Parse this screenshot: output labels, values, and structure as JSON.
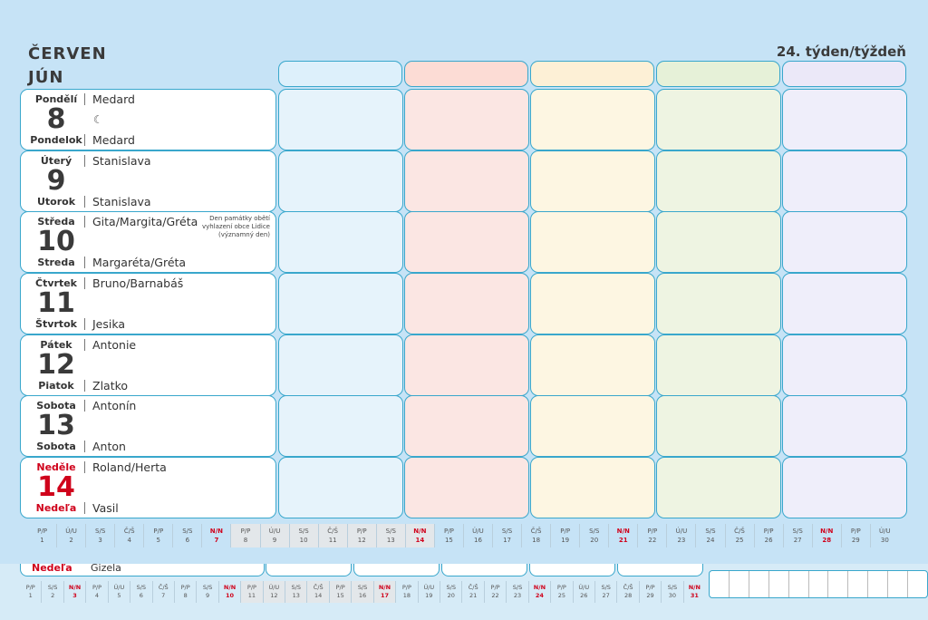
{
  "header": {
    "month_cz": "ČERVEN",
    "month_sk": "JÚN",
    "week": "24. týden/týždeň"
  },
  "days": [
    {
      "cz_day": "Pondělí",
      "sk_day": "Pondelok",
      "num": "8",
      "cz_name": "Medard",
      "sk_name": "Medard",
      "moon": "☾",
      "note": "",
      "sunday": false
    },
    {
      "cz_day": "Úterý",
      "sk_day": "Utorok",
      "num": "9",
      "cz_name": "Stanislava",
      "sk_name": "Stanislava",
      "moon": "",
      "note": "",
      "sunday": false
    },
    {
      "cz_day": "Středa",
      "sk_day": "Streda",
      "num": "10",
      "cz_name": "Gita/Margita/Gréta",
      "sk_name": "Margaréta/Gréta",
      "moon": "",
      "note": "Den památky obětí vyhlazení obce Lidice (významný den)",
      "sunday": false
    },
    {
      "cz_day": "Čtvrtek",
      "sk_day": "Štvrtok",
      "num": "11",
      "cz_name": "Bruno/Barnabáš",
      "sk_name": "Jesika",
      "moon": "",
      "note": "",
      "sunday": false
    },
    {
      "cz_day": "Pátek",
      "sk_day": "Piatok",
      "num": "12",
      "cz_name": "Antonie",
      "sk_name": "Zlatko",
      "moon": "",
      "note": "",
      "sunday": false
    },
    {
      "cz_day": "Sobota",
      "sk_day": "Sobota",
      "num": "13",
      "cz_name": "Antonín",
      "sk_name": "Anton",
      "moon": "",
      "note": "",
      "sunday": false
    },
    {
      "cz_day": "Neděle",
      "sk_day": "Nedeľa",
      "num": "14",
      "cz_name": "Roland/Herta",
      "sk_name": "Vasil",
      "moon": "",
      "note": "",
      "sunday": true
    }
  ],
  "mini_calendar": [
    {
      "abbr": "P/P",
      "d": "1"
    },
    {
      "abbr": "Ú/U",
      "d": "2"
    },
    {
      "abbr": "S/S",
      "d": "3"
    },
    {
      "abbr": "Č/Š",
      "d": "4"
    },
    {
      "abbr": "P/P",
      "d": "5"
    },
    {
      "abbr": "S/S",
      "d": "6"
    },
    {
      "abbr": "N/N",
      "d": "7",
      "red": true
    },
    {
      "abbr": "P/P",
      "d": "8",
      "hl": true
    },
    {
      "abbr": "Ú/U",
      "d": "9",
      "hl": true
    },
    {
      "abbr": "S/S",
      "d": "10",
      "hl": true
    },
    {
      "abbr": "Č/Š",
      "d": "11",
      "hl": true
    },
    {
      "abbr": "P/P",
      "d": "12",
      "hl": true
    },
    {
      "abbr": "S/S",
      "d": "13",
      "hl": true
    },
    {
      "abbr": "N/N",
      "d": "14",
      "red": true,
      "hl": true
    },
    {
      "abbr": "P/P",
      "d": "15"
    },
    {
      "abbr": "Ú/U",
      "d": "16"
    },
    {
      "abbr": "S/S",
      "d": "17"
    },
    {
      "abbr": "Č/Š",
      "d": "18"
    },
    {
      "abbr": "P/P",
      "d": "19"
    },
    {
      "abbr": "S/S",
      "d": "20"
    },
    {
      "abbr": "N/N",
      "d": "21",
      "red": true
    },
    {
      "abbr": "P/P",
      "d": "22"
    },
    {
      "abbr": "Ú/U",
      "d": "23"
    },
    {
      "abbr": "S/S",
      "d": "24"
    },
    {
      "abbr": "Č/Š",
      "d": "25"
    },
    {
      "abbr": "P/P",
      "d": "26"
    },
    {
      "abbr": "S/S",
      "d": "27"
    },
    {
      "abbr": "N/N",
      "d": "28",
      "red": true
    },
    {
      "abbr": "P/P",
      "d": "29"
    },
    {
      "abbr": "Ú/U",
      "d": "30"
    }
  ],
  "lower": {
    "sunday_label": "Nedeľa",
    "name": "Gizela"
  },
  "mini_calendar_2": [
    {
      "abbr": "P/P",
      "d": "1"
    },
    {
      "abbr": "S/S",
      "d": "2"
    },
    {
      "abbr": "N/N",
      "d": "3",
      "red": true
    },
    {
      "abbr": "P/P",
      "d": "4"
    },
    {
      "abbr": "Ú/U",
      "d": "5"
    },
    {
      "abbr": "S/S",
      "d": "6"
    },
    {
      "abbr": "Č/Š",
      "d": "7"
    },
    {
      "abbr": "P/P",
      "d": "8"
    },
    {
      "abbr": "S/S",
      "d": "9"
    },
    {
      "abbr": "N/N",
      "d": "10",
      "red": true
    },
    {
      "abbr": "P/P",
      "d": "11",
      "hl": true
    },
    {
      "abbr": "Ú/U",
      "d": "12",
      "hl": true
    },
    {
      "abbr": "S/S",
      "d": "13",
      "hl": true
    },
    {
      "abbr": "Č/Š",
      "d": "14",
      "hl": true
    },
    {
      "abbr": "P/P",
      "d": "15",
      "hl": true
    },
    {
      "abbr": "S/S",
      "d": "16",
      "hl": true
    },
    {
      "abbr": "N/N",
      "d": "17",
      "red": true,
      "hl": true
    },
    {
      "abbr": "P/P",
      "d": "18"
    },
    {
      "abbr": "Ú/U",
      "d": "19"
    },
    {
      "abbr": "S/S",
      "d": "20"
    },
    {
      "abbr": "Č/Š",
      "d": "21"
    },
    {
      "abbr": "P/P",
      "d": "22"
    },
    {
      "abbr": "S/S",
      "d": "23"
    },
    {
      "abbr": "N/N",
      "d": "24",
      "red": true
    },
    {
      "abbr": "P/P",
      "d": "25"
    },
    {
      "abbr": "Ú/U",
      "d": "26"
    },
    {
      "abbr": "S/S",
      "d": "27"
    },
    {
      "abbr": "Č/Š",
      "d": "28"
    },
    {
      "abbr": "P/P",
      "d": "29"
    },
    {
      "abbr": "S/S",
      "d": "30"
    },
    {
      "abbr": "N/N",
      "d": "31",
      "red": true
    }
  ]
}
